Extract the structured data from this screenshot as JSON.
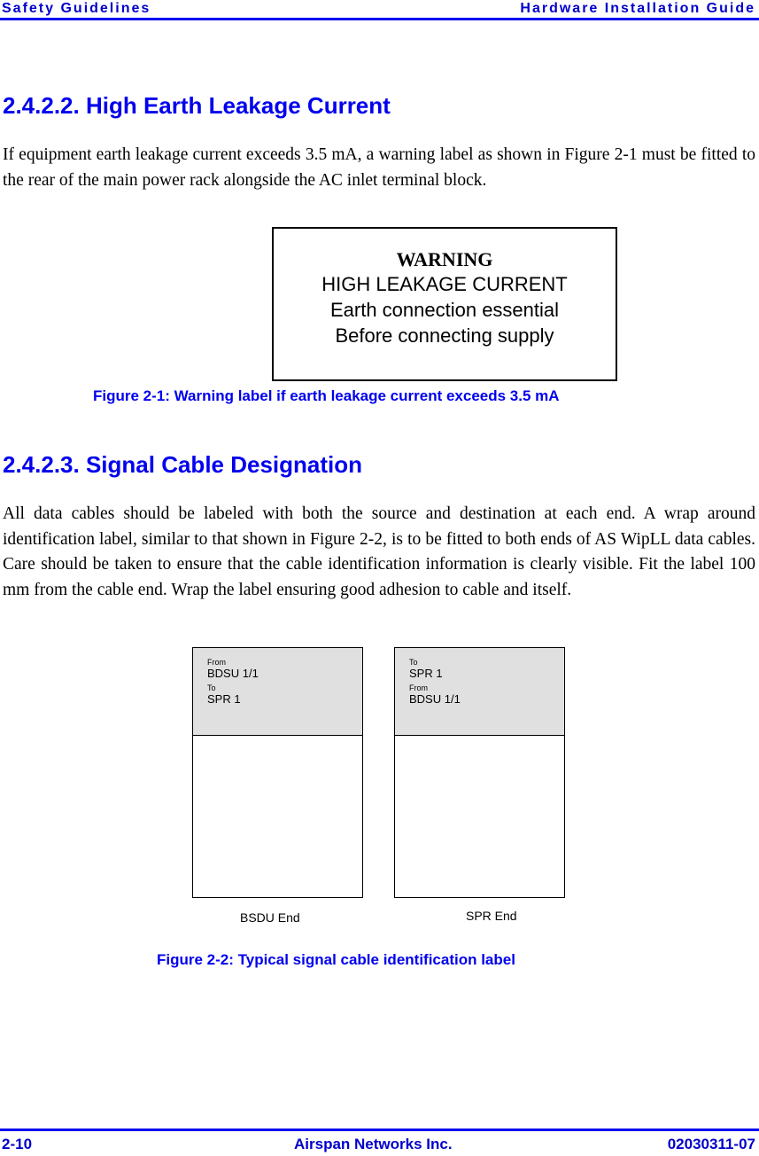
{
  "header": {
    "left": "Safety Guidelines",
    "right": "Hardware Installation Guide"
  },
  "section1": {
    "heading": "2.4.2.2. High Earth Leakage Current",
    "paragraph": "If equipment earth leakage current exceeds 3.5 mA, a warning label as shown in Figure 2-1 must be fitted to the rear of the main power rack alongside the AC inlet terminal block."
  },
  "warning_label": {
    "title": "WARNING",
    "lines": [
      "HIGH LEAKAGE CURRENT",
      "Earth connection essential",
      "Before connecting supply"
    ]
  },
  "figure1_caption": "Figure 2-1: Warning label if earth leakage current exceeds 3.5 mA",
  "section2": {
    "heading": "2.4.2.3. Signal Cable Designation",
    "paragraph": "All data cables should be labeled with both the source and destination at each end. A wrap around identification label, similar to that shown in Figure 2-2, is to be fitted to both ends of AS WipLL data cables. Care should be taken to ensure that the cable identification information is clearly visible. Fit the label 100 mm from the cable end. Wrap the label ensuring good adhesion to cable and itself."
  },
  "cable_labels": [
    {
      "rows": [
        {
          "key": "From",
          "value": "BDSU 1/1"
        },
        {
          "key": "To",
          "value": "SPR 1"
        }
      ],
      "end_label": "BSDU End"
    },
    {
      "rows": [
        {
          "key": "To",
          "value": "SPR 1"
        },
        {
          "key": "From",
          "value": "BDSU 1/1"
        }
      ],
      "end_label": "SPR End"
    }
  ],
  "figure2_caption": "Figure 2-2:  Typical signal cable identification label",
  "footer": {
    "left": "2-10",
    "center": "Airspan Networks Inc.",
    "right": "02030311-07"
  }
}
